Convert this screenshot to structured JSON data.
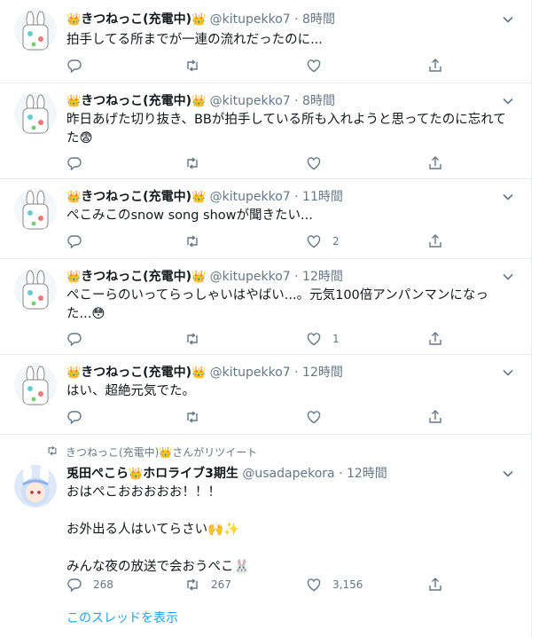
{
  "colors": {
    "accent": "#1da1f2",
    "muted": "#657786",
    "border": "#e6ecf0",
    "text": "#14171a"
  },
  "icons": {
    "reply": "reply-icon",
    "retweet": "retweet-icon",
    "like": "heart-icon",
    "share": "share-icon",
    "caret": "chevron-down-icon"
  },
  "tweets": [
    {
      "name": "きつねっこ(充電中)",
      "crown": "👑",
      "handle": "@kitupekko7",
      "sep": "·",
      "time": "8時間",
      "text": "拍手してる所までが一連の流れだったのに...",
      "replies": "",
      "retweets": "",
      "likes": ""
    },
    {
      "name": "きつねっこ(充電中)",
      "crown": "👑",
      "handle": "@kitupekko7",
      "sep": "·",
      "time": "8時間",
      "text": "昨日あげた切り抜き、BBが拍手している所も入れようと思ってたのに忘れてた😨",
      "replies": "",
      "retweets": "",
      "likes": ""
    },
    {
      "name": "きつねっこ(充電中)",
      "crown": "👑",
      "handle": "@kitupekko7",
      "sep": "·",
      "time": "11時間",
      "text": "ぺこみこのsnow song showが聞きたい...",
      "replies": "",
      "retweets": "",
      "likes": "2"
    },
    {
      "name": "きつねっこ(充電中)",
      "crown": "👑",
      "handle": "@kitupekko7",
      "sep": "·",
      "time": "12時間",
      "text": "ぺこーらのいってらっしゃいはやばい...。元気100倍アンパンマンになった...😳",
      "replies": "",
      "retweets": "",
      "likes": "1"
    },
    {
      "name": "きつねっこ(充電中)",
      "crown": "👑",
      "handle": "@kitupekko7",
      "sep": "·",
      "time": "12時間",
      "text": "はい、超絶元気でた。",
      "replies": "",
      "retweets": "",
      "likes": ""
    }
  ],
  "retweet_notice": "きつねっこ(充電中)👑さんがリツイート",
  "pekora": {
    "name_a": "兎田ぺこら",
    "name_b": "ホロライブ3期生",
    "crown": "👑",
    "handle": "@usadapekora",
    "sep": "·",
    "time": "12時間",
    "text": "おはぺこおおおおお！！！\n\nお外出る人はいてらさい🙌✨\n\nみんな夜の放送で会おうぺこ🐰",
    "replies": "268",
    "retweets": "267",
    "likes": "3,156"
  },
  "thread_link": "このスレッドを表示"
}
